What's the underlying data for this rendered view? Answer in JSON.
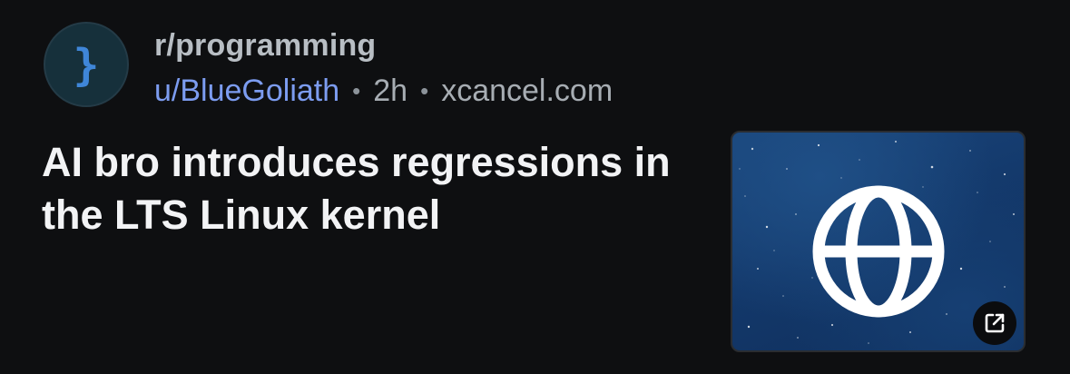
{
  "post": {
    "subreddit": "r/programming",
    "username": "u/BlueGoliath",
    "separator": "•",
    "age": "2h",
    "domain": "xcancel.com",
    "title": "AI bro introduces regressions in the LTS Linux kernel"
  },
  "avatar": {
    "icon": "curly-brace-icon",
    "glyph": "}"
  },
  "thumbnail": {
    "icon": "globe-icon",
    "badge_icon": "external-link-icon"
  },
  "colors": {
    "background": "#0e0f11",
    "username": "#7c9cf0",
    "title": "#f2f3f5",
    "meta": "#a7adb3",
    "avatar_glyph": "#3f86d8"
  }
}
